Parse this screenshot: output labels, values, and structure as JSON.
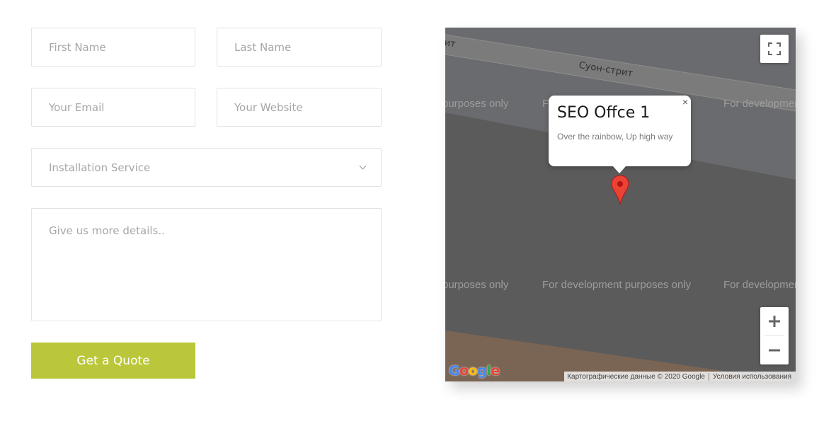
{
  "form": {
    "first_name_placeholder": "First Name",
    "last_name_placeholder": "Last Name",
    "email_placeholder": "Your Email",
    "website_placeholder": "Your Website",
    "service_selected": "Installation Service",
    "details_placeholder": "Give us more details..",
    "submit_label": "Get a Quote",
    "accent_color": "#bac73a"
  },
  "map": {
    "street_label_1": "Суон-стрит",
    "street_label_2": "ит",
    "watermarks": {
      "row1_left": "purposes only",
      "row1_mid": "F",
      "row1_right": "For developmen",
      "row2_left": "purposes only",
      "row2_mid": "For development purposes only",
      "row2_right": "For developmen"
    },
    "info_window": {
      "title": "SEO Offce 1",
      "description": "Over the rainbow, Up high way",
      "close_symbol": "×"
    },
    "marker_color": "#ea4335",
    "zoom_in": "+",
    "zoom_out": "−",
    "google_logo": [
      "G",
      "o",
      "o",
      "g",
      "l",
      "e"
    ],
    "attribution": "Картографические данные © 2020 Google",
    "terms": "Условия использования"
  }
}
